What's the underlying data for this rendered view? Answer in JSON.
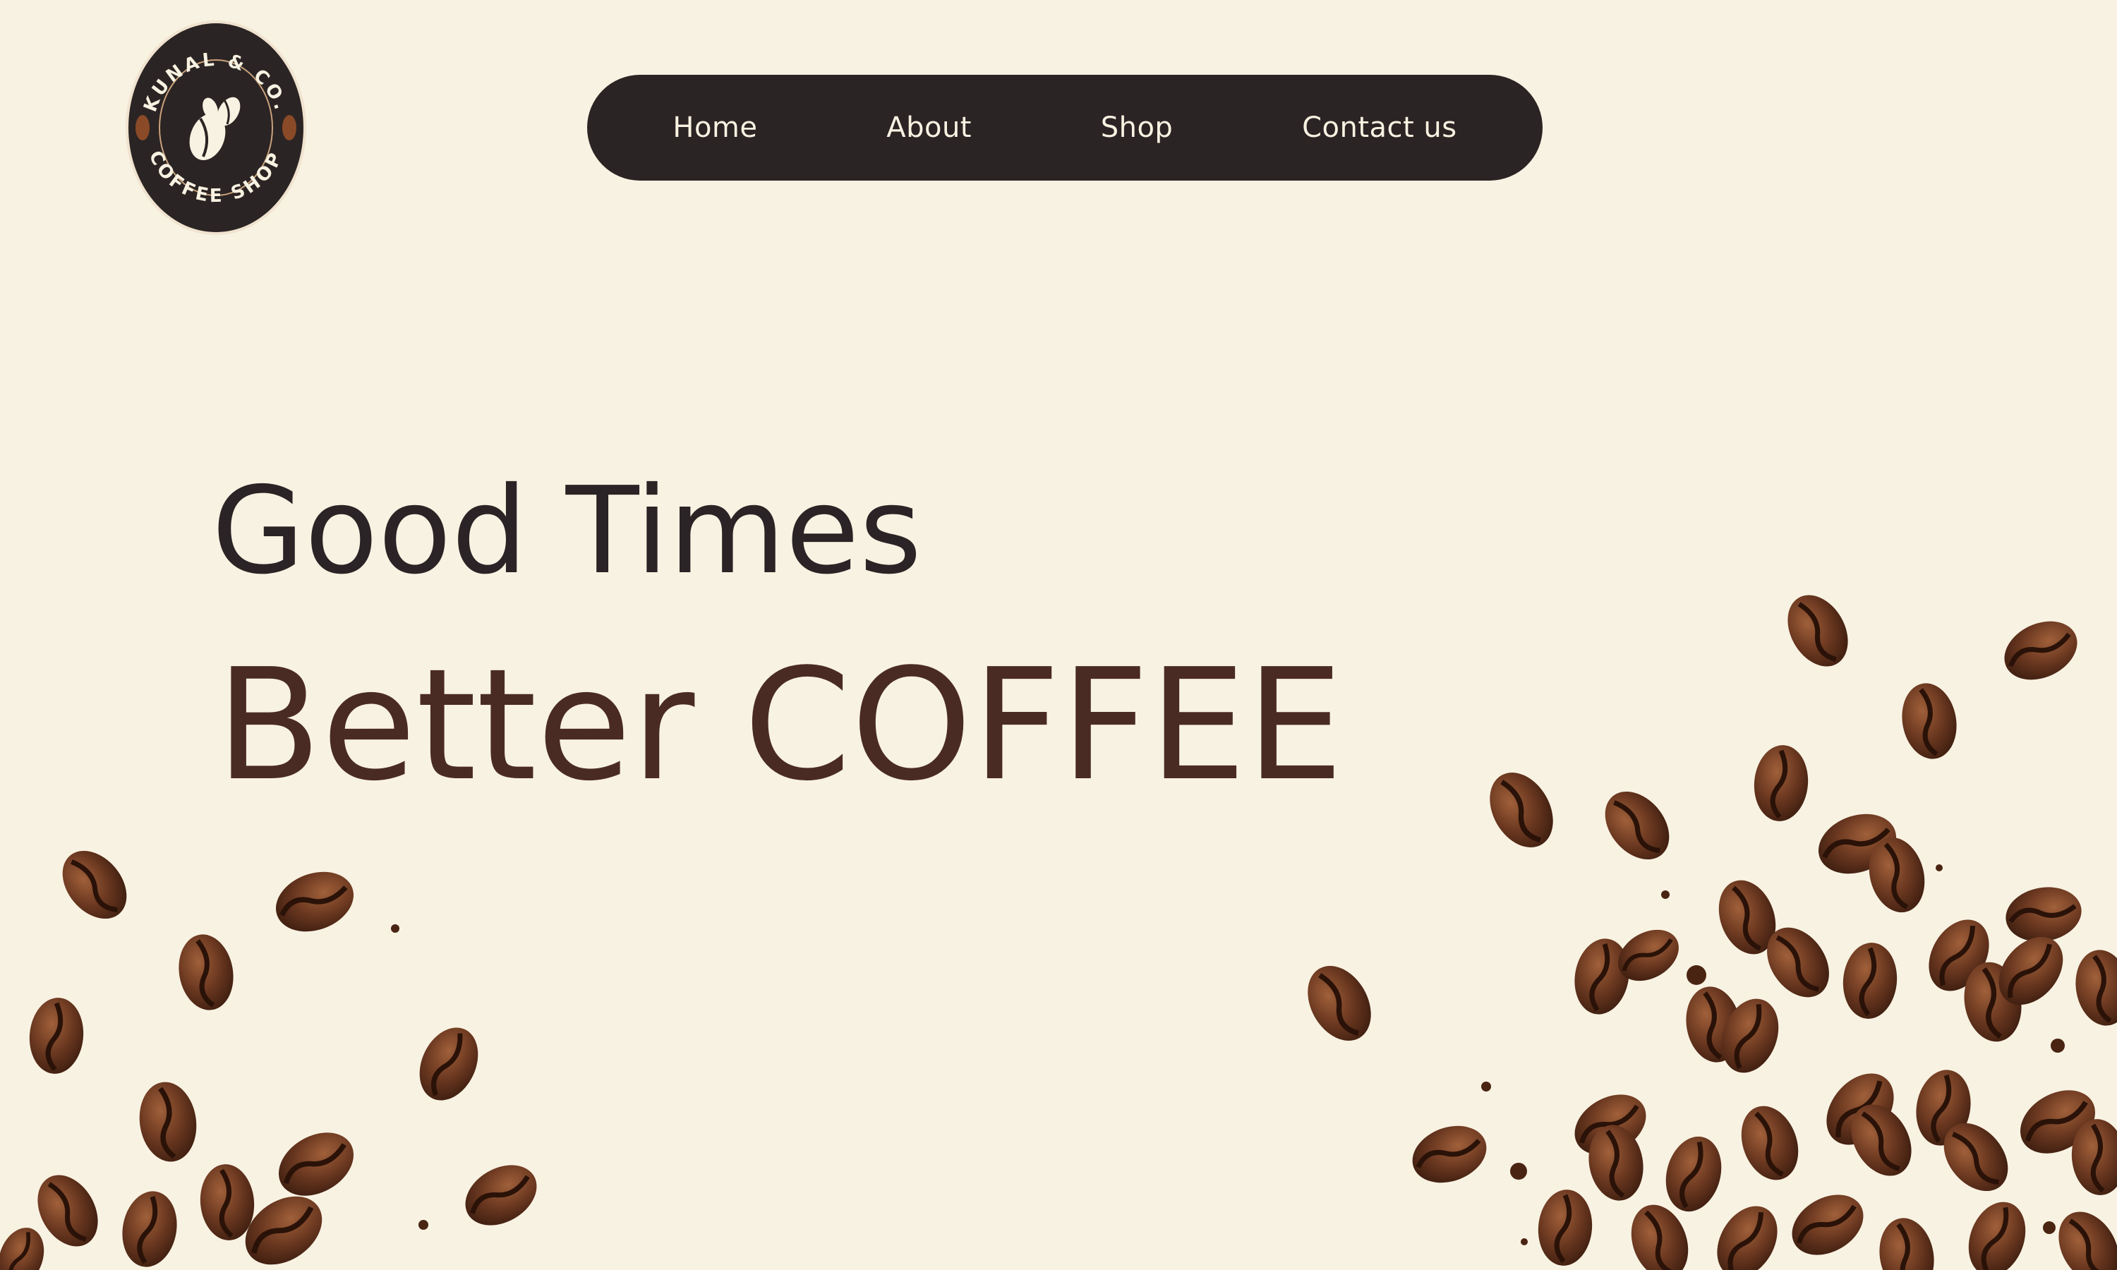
{
  "logo": {
    "top_text": "KUNAL & CO.",
    "bottom_text": "COFFEE SHOP"
  },
  "nav": {
    "items": [
      {
        "label": "Home"
      },
      {
        "label": "About"
      },
      {
        "label": "Shop"
      },
      {
        "label": "Contact us"
      }
    ]
  },
  "hero": {
    "line1": "Good Times",
    "line2": "Better COFFEE"
  },
  "colors": {
    "background": "#f8f2e2",
    "nav_background": "#2b2424",
    "nav_text": "#f8f2e2",
    "headline_dark": "#2a2426",
    "headline_brown": "#4a2b24",
    "bean": "#5a2f1c"
  },
  "icons": {
    "logo_mark": "coffee-beans-icon"
  }
}
